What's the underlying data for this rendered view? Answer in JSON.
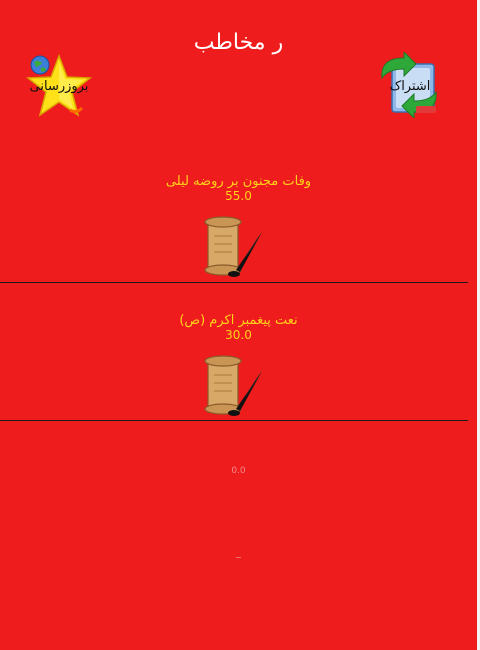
{
  "header": {
    "title": "ر مخاطب"
  },
  "buttons": {
    "update_label": "بروزرسانی",
    "share_label": "اشتراک"
  },
  "items": [
    {
      "title": "وفات مجنون بر روضه لیلی",
      "value": "55.0",
      "icon": "scroll-quill-icon"
    },
    {
      "title": "نعت پیغمبر اکرم (ص)",
      "value": "30.0",
      "icon": "scroll-quill-icon"
    }
  ],
  "faint_item": {
    "value": "0.0"
  },
  "colors": {
    "background": "#ee1c1c",
    "item_text": "#ffd21a",
    "title_text": "#ffffff",
    "divider": "#1a1a1a"
  }
}
